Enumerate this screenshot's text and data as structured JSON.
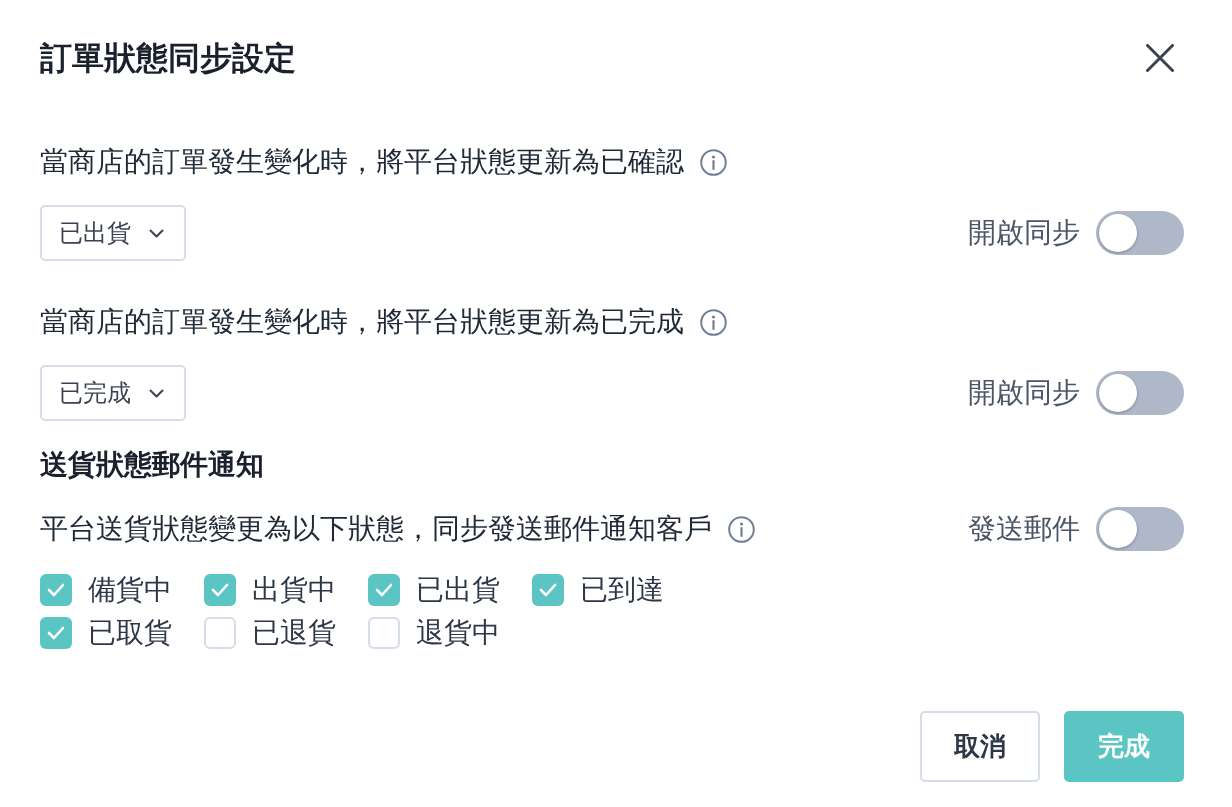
{
  "dialog": {
    "title": "訂單狀態同步設定"
  },
  "sync_settings": [
    {
      "label": "當商店的訂單發生變化時，將平台狀態更新為已確認",
      "select": {
        "value": "已出貨"
      },
      "toggle": {
        "label": "開啟同步",
        "on": false
      }
    },
    {
      "label": "當商店的訂單發生變化時，將平台狀態更新為已完成",
      "select": {
        "value": "已完成"
      },
      "toggle": {
        "label": "開啟同步",
        "on": false
      }
    }
  ],
  "email_notification": {
    "heading": "送貨狀態郵件通知",
    "description": "平台送貨狀態變更為以下狀態，同步發送郵件通知客戶",
    "toggle": {
      "label": "發送郵件",
      "on": false
    },
    "statuses": [
      {
        "label": "備貨中",
        "checked": true
      },
      {
        "label": "出貨中",
        "checked": true
      },
      {
        "label": "已出貨",
        "checked": true
      },
      {
        "label": "已到達",
        "checked": true
      },
      {
        "label": "已取貨",
        "checked": true
      },
      {
        "label": "已退貨",
        "checked": false
      },
      {
        "label": "退貨中",
        "checked": false
      }
    ]
  },
  "buttons": [
    {
      "label": "取消",
      "kind": "secondary"
    },
    {
      "label": "完成",
      "kind": "primary"
    }
  ]
}
